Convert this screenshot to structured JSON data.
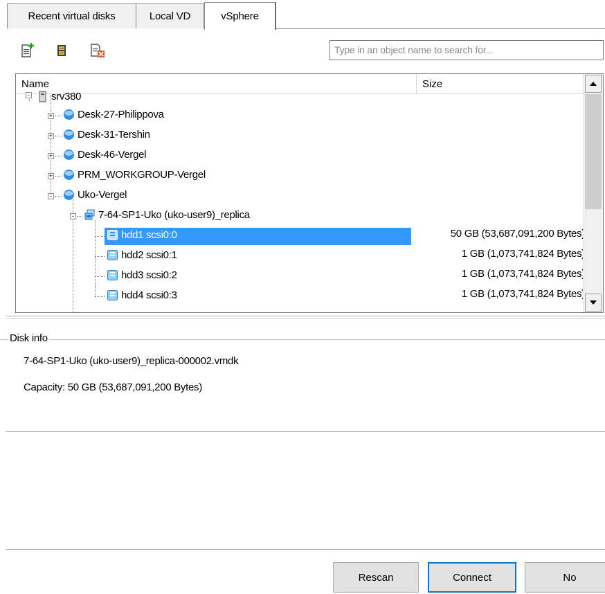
{
  "tabs": [
    {
      "label": "Recent virtual disks",
      "active": false
    },
    {
      "label": "Local VD",
      "active": false
    },
    {
      "label": "vSphere",
      "active": true
    }
  ],
  "toolbar": {
    "buttons": [
      {
        "icon": "new-document-icon"
      },
      {
        "icon": "disk-properties-icon"
      },
      {
        "icon": "delete-disk-icon"
      }
    ],
    "search": {
      "placeholder": "Type in an object name to search for..."
    }
  },
  "list": {
    "columns": {
      "name": "Name",
      "size": "Size"
    },
    "rows": [
      {
        "label": "srv380",
        "size": "",
        "level": 0,
        "icon": "server-icon",
        "expander": "-"
      },
      {
        "label": "Desk-27-Philippova",
        "size": "",
        "level": 1,
        "icon": "resource-pool-icon",
        "expander": "+"
      },
      {
        "label": "Desk-31-Tershin",
        "size": "",
        "level": 1,
        "icon": "resource-pool-icon",
        "expander": "+"
      },
      {
        "label": "Desk-46-Vergel",
        "size": "",
        "level": 1,
        "icon": "resource-pool-icon",
        "expander": "+"
      },
      {
        "label": "PRM_WORKGROUP-Vergel",
        "size": "",
        "level": 1,
        "icon": "resource-pool-icon",
        "expander": "+"
      },
      {
        "label": "Uko-Vergel",
        "size": "",
        "level": 1,
        "icon": "resource-pool-icon",
        "expander": "-"
      },
      {
        "label": "7-64-SP1-Uko (uko-user9)_replica",
        "size": "",
        "level": 2,
        "icon": "virtual-machine-icon",
        "expander": "-"
      },
      {
        "label": "hdd1 scsi0:0",
        "size": "50 GB (53,687,091,200 Bytes)",
        "level": 3,
        "icon": "virtual-disk-icon",
        "expander": "",
        "selected": true
      },
      {
        "label": "hdd2 scsi0:1",
        "size": "1 GB (1,073,741,824 Bytes)",
        "level": 3,
        "icon": "virtual-disk-icon",
        "expander": ""
      },
      {
        "label": "hdd3 scsi0:2",
        "size": "1 GB (1,073,741,824 Bytes)",
        "level": 3,
        "icon": "virtual-disk-icon",
        "expander": ""
      },
      {
        "label": "hdd4 scsi0:3",
        "size": "1 GB (1,073,741,824 Bytes)",
        "level": 3,
        "icon": "virtual-disk-icon",
        "expander": ""
      }
    ]
  },
  "disk_info": {
    "group_label": "Disk info",
    "file_name": "7-64-SP1-Uko (uko-user9)_replica-000002.vmdk",
    "capacity_label": "Capacity:",
    "capacity_value": "50 GB (53,687,091,200 Bytes)"
  },
  "buttons": {
    "rescan": "Rescan",
    "connect": "Connect",
    "no": "No"
  },
  "colors": {
    "selection": "#3399ff",
    "focus_border": "#0078d7"
  }
}
